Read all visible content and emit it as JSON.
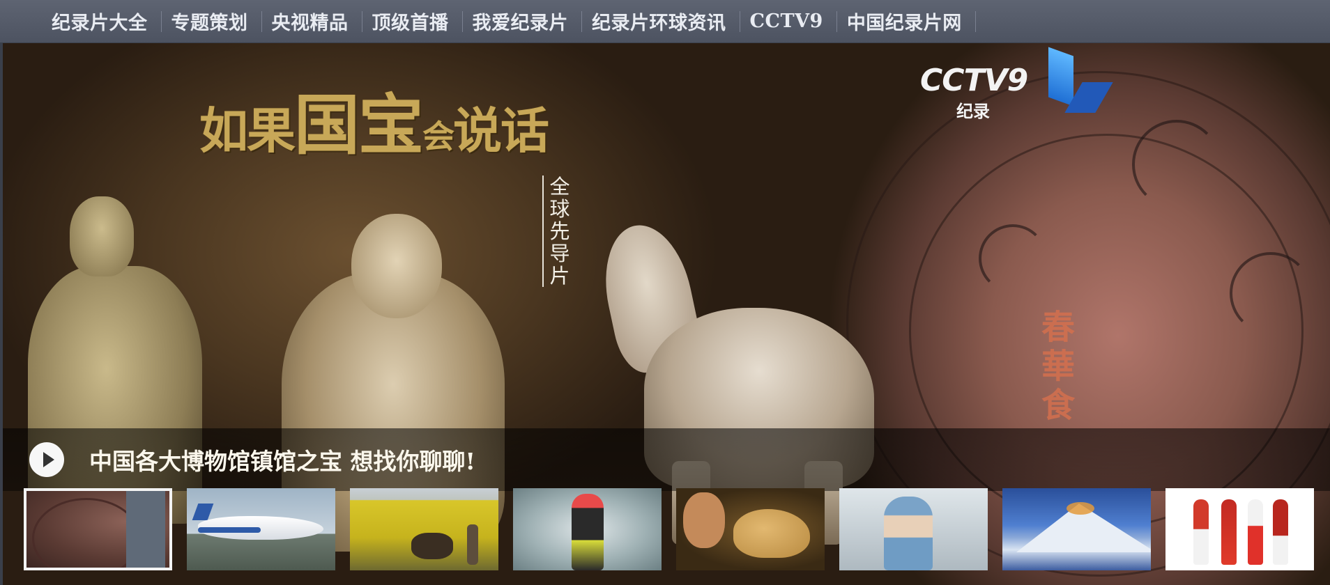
{
  "nav": {
    "items": [
      {
        "label": "纪录片大全"
      },
      {
        "label": "专题策划"
      },
      {
        "label": "央视精品"
      },
      {
        "label": "顶级首播"
      },
      {
        "label": "我爱纪录片"
      },
      {
        "label": "纪录片环球资讯"
      },
      {
        "label": "CCTV9"
      },
      {
        "label": "中国纪录片网"
      }
    ]
  },
  "hero": {
    "title_art": {
      "c1": "如",
      "c2": "果",
      "c3": "国",
      "c4": "宝",
      "c5": "会",
      "c6": "说话"
    },
    "subtitle_vertical": "全球先导片",
    "logo": {
      "text": "CCTV9",
      "sub": "纪录"
    },
    "seal_text": "春華食",
    "caption": "中国各大博物馆镇馆之宝 想找你聊聊!"
  },
  "thumbnails": [
    {
      "subject": "ancient-lacquer-dish",
      "active": true
    },
    {
      "subject": "passenger-airplane",
      "active": false
    },
    {
      "subject": "farmer-rapeseed-field",
      "active": false
    },
    {
      "subject": "whitewater-rafter",
      "active": false
    },
    {
      "subject": "person-and-dog",
      "active": false
    },
    {
      "subject": "surgeon",
      "active": false
    },
    {
      "subject": "mount-everest",
      "active": false
    },
    {
      "subject": "dancing-people",
      "active": false
    }
  ],
  "colors": {
    "nav_bg": "#555b69",
    "nav_text": "#e9ecf2",
    "caption_text": "#fbf7ec",
    "title_gold": "#c8a858",
    "active_border": "#f3f3f3"
  }
}
